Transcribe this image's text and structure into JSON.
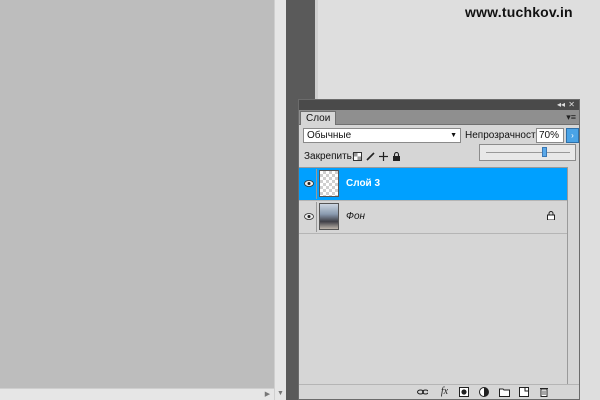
{
  "watermark": "www.tuchkov.in",
  "panel": {
    "tab_label": "Слои",
    "menu_icon": "panel-menu-icon",
    "collapse_icon": "double-chevron-left-icon",
    "close_icon": "close-icon"
  },
  "blend_mode": {
    "value": "Обычные",
    "opacity_label": "Непрозрачность:",
    "opacity_value": "70%",
    "opacity_slider_fraction": 0.7
  },
  "lock": {
    "label": "Закрепить:",
    "icons": [
      "lock-transparent-pixels-icon",
      "lock-image-pixels-icon",
      "lock-position-icon",
      "lock-all-icon"
    ]
  },
  "layers": [
    {
      "name": "Слой 3",
      "selected": true,
      "visible": true,
      "thumbnail": "transparent-checkerboard",
      "locked": false
    },
    {
      "name": "Фон",
      "selected": false,
      "visible": true,
      "thumbnail": "photo",
      "locked": true
    }
  ],
  "footer_icons": [
    "link-layers-icon",
    "fx-icon",
    "add-mask-icon",
    "adjustment-layer-icon",
    "new-group-icon",
    "new-layer-icon",
    "trash-icon"
  ],
  "colors": {
    "selection": "#00a0ff",
    "panel_bg": "#d6d6d6",
    "canvas_bg": "#bdbdbd",
    "dark_gap": "#5a5a5a"
  }
}
